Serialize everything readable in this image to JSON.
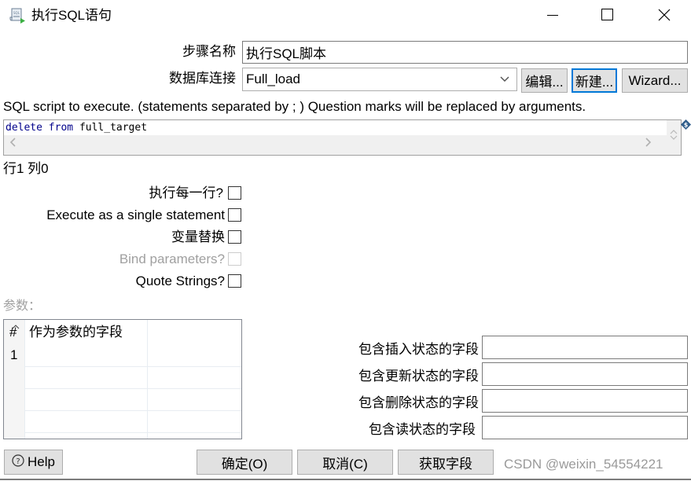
{
  "window": {
    "title": "执行SQL语句",
    "app_icon": "sql-script-icon",
    "controls": {
      "minimize": "minimize-icon",
      "maximize": "maximize-icon",
      "close": "close-icon"
    }
  },
  "form": {
    "step_name_label": "步骤名称",
    "step_name_value": "执行SQL脚本",
    "db_connection_label": "数据库连接",
    "db_connection_value": "Full_load",
    "edit_button": "编辑...",
    "new_button": "新建...",
    "wizard_button": "Wizard..."
  },
  "sql": {
    "description": "SQL script to execute. (statements separated by ; ) Question marks will be replaced by arguments.",
    "keyword1": "delete",
    "keyword2": "from",
    "identifier": "full_target",
    "cursor_position": "行1 列0"
  },
  "options": [
    {
      "label": "执行每一行?",
      "checked": false,
      "disabled": false
    },
    {
      "label": "Execute as a single statement",
      "checked": false,
      "disabled": false
    },
    {
      "label": "变量替换",
      "checked": false,
      "disabled": false
    },
    {
      "label": "Bind parameters?",
      "checked": false,
      "disabled": true
    },
    {
      "label": "Quote Strings?",
      "checked": false,
      "disabled": false
    }
  ],
  "params": {
    "label": "参数：",
    "columns": [
      "#",
      "作为参数的字段"
    ],
    "rows": [
      {
        "num": "1",
        "field": ""
      }
    ]
  },
  "status_fields": [
    {
      "label": "包含插入状态的字段",
      "value": ""
    },
    {
      "label": "包含更新状态的字段",
      "value": ""
    },
    {
      "label": "包含删除状态的字段",
      "value": ""
    },
    {
      "label": "包含读状态的字段",
      "value": ""
    }
  ],
  "footer": {
    "help_button": "Help",
    "ok_button": "确定(O)",
    "cancel_button": "取消(C)",
    "get_fields_button": "获取字段",
    "watermark": "CSDN @weixin_54554221"
  },
  "colors": {
    "focus_border": "#0078d7",
    "sql_keyword": "#00008b",
    "button_bg": "#e1e1e1"
  }
}
